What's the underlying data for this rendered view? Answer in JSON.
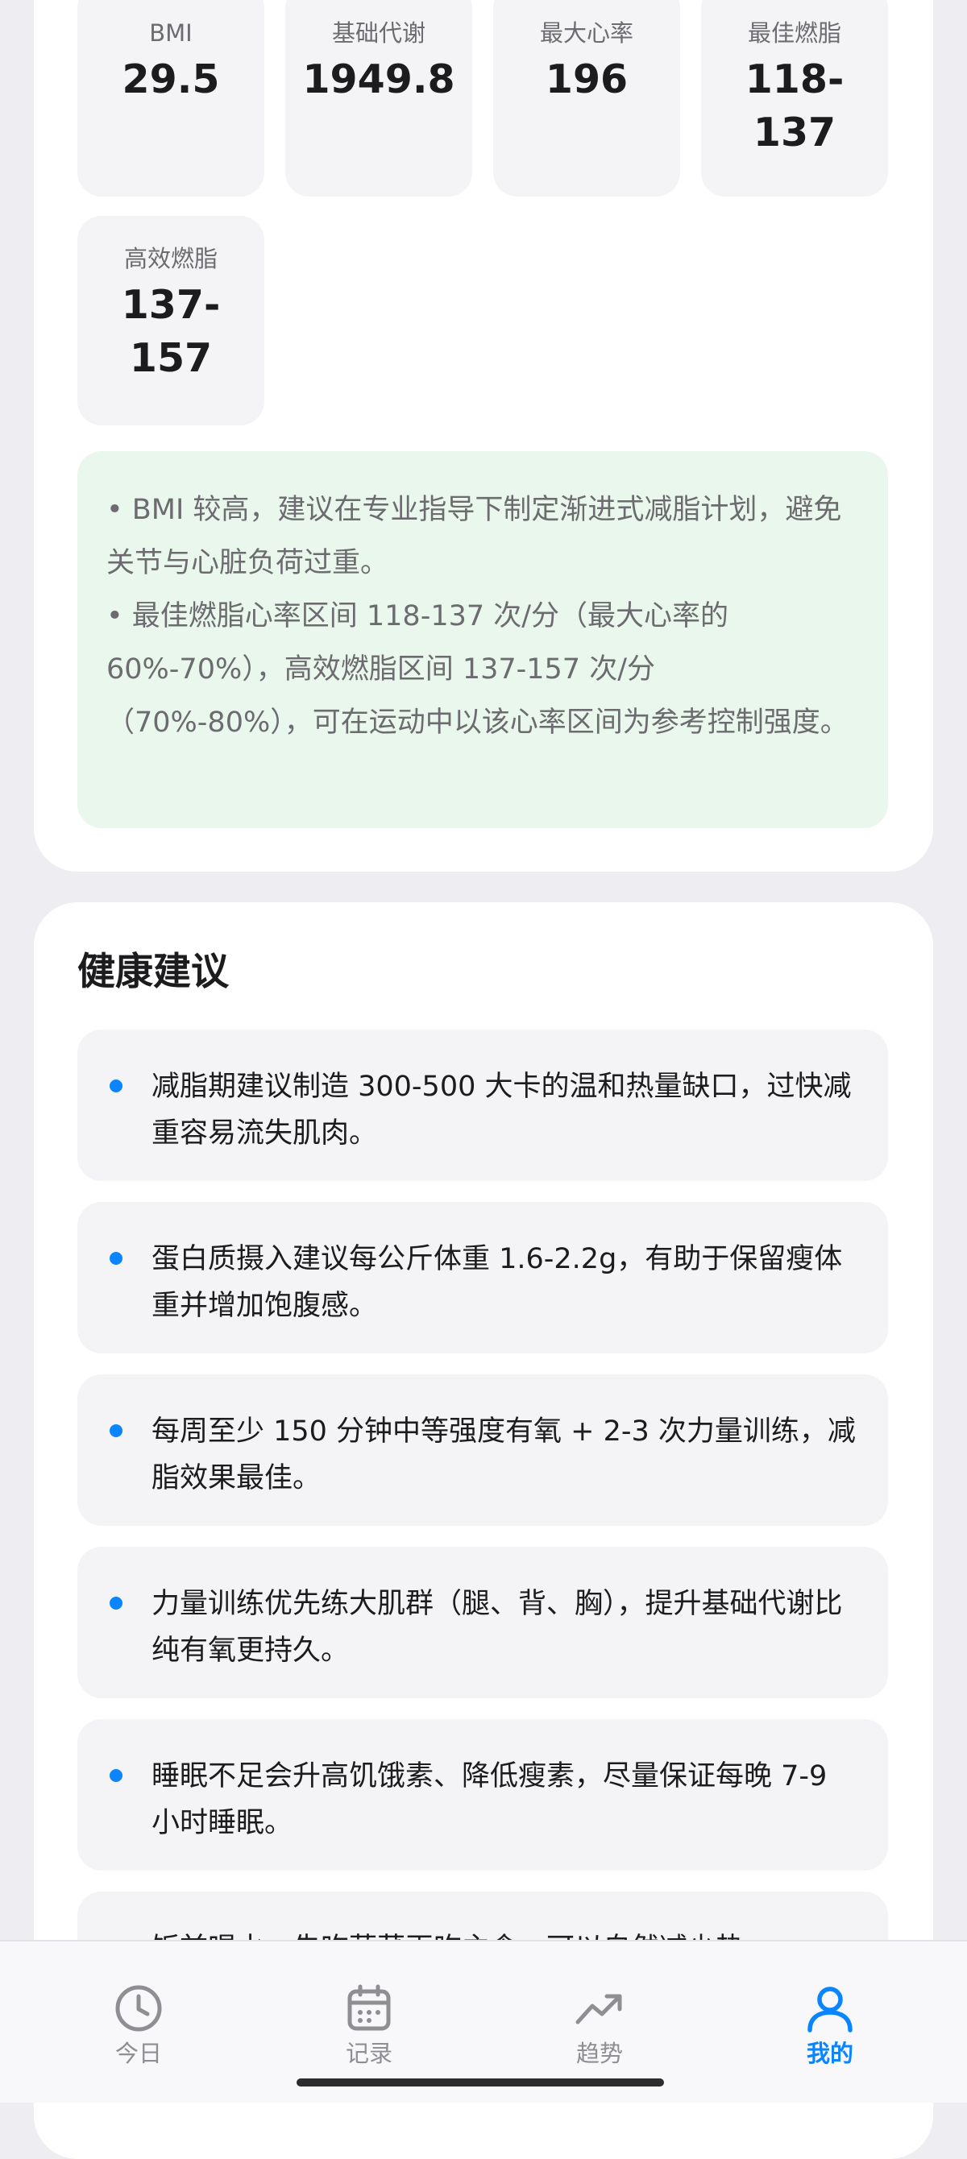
{
  "stats": [
    {
      "label": "BMI",
      "value": "29.5"
    },
    {
      "label": "基础代谢",
      "value": "1949.8"
    },
    {
      "label": "最大心率",
      "value": "196"
    },
    {
      "label": "最佳燃脂",
      "value": "118-137"
    },
    {
      "label": "高效燃脂",
      "value": "137-157"
    }
  ],
  "tips": [
    "• BMI 较高，建议在专业指导下制定渐进式减脂计划，避免关节与心脏负荷过重。",
    "• 最佳燃脂心率区间 118-137 次/分（最大心率的 60%-70%），高效燃脂区间 137-157 次/分（70%-80%），可在运动中以该心率区间为参考控制强度。"
  ],
  "advice": {
    "title": "健康建议",
    "items": [
      "减脂期建议制造 300-500 大卡的温和热量缺口，过快减重容易流失肌肉。",
      "蛋白质摄入建议每公斤体重 1.6-2.2g，有助于保留瘦体重并增加饱腹感。",
      "每周至少 150 分钟中等强度有氧 + 2-3 次力量训练，减脂效果最佳。",
      "力量训练优先练大肌群（腿、背、胸），提升基础代谢比纯有氧更持久。",
      "睡眠不足会升高饥饿素、降低瘦素，尽量保证每晚 7-9 小时睡眠。",
      "饭前喝水、先吃蔬菜再吃主食，可以自然减少热"
    ]
  },
  "tabbar": {
    "tabs": [
      {
        "label": "今日",
        "icon": "clock-icon"
      },
      {
        "label": "记录",
        "icon": "calendar-icon"
      },
      {
        "label": "趋势",
        "icon": "trend-icon"
      },
      {
        "label": "我的",
        "icon": "person-icon"
      }
    ],
    "active": "我的",
    "accent": "#0a84ff"
  }
}
